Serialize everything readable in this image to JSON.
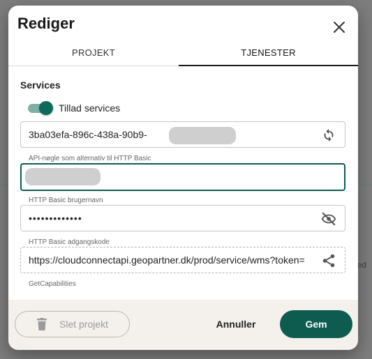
{
  "background": {
    "partial_text": "ed"
  },
  "dialog": {
    "title": "Rediger",
    "tabs": [
      {
        "label": "PROJEKT",
        "active": false
      },
      {
        "label": "TJENESTER",
        "active": true
      }
    ],
    "section_title": "Services",
    "toggle": {
      "label": "Tillad services",
      "checked": true
    },
    "fields": {
      "api_key": {
        "value": "3ba03efa-896c-438a-90b9-",
        "caption": "API-nøgle som alternativ til HTTP Basic",
        "icon": "refresh-icon"
      },
      "username": {
        "value": "",
        "caption": "HTTP Basic brugernavn"
      },
      "password": {
        "value": "•••••••••••••",
        "caption": "HTTP Basic adgangskode",
        "icon": "eye-off-icon"
      },
      "capabilities_url": {
        "value": "https://cloudconnectapi.geopartner.dk/prod/service/wms?token=",
        "caption": "GetCapabilities",
        "icon": "share-icon"
      }
    },
    "footer": {
      "delete_label": "Slet projekt",
      "cancel_label": "Annuller",
      "save_label": "Gem"
    }
  },
  "colors": {
    "primary": "#0d5c4f",
    "toggle_track": "#7fb1a3",
    "footer_bg": "#f4f1ed"
  }
}
